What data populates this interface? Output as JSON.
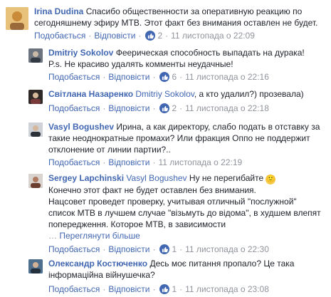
{
  "actions": {
    "like": "Подобається",
    "reply": "Відповісти",
    "dot": "·"
  },
  "comments": [
    {
      "author": "Irina Dudina",
      "text_lines": [
        "Спасибо общественности за оперативную реакцию по",
        "сегодняшнему эфиру МТВ. Этот факт без внимания оставлен не будет."
      ],
      "likes": "2",
      "time": "11 листопада о 22:09",
      "avatar_color": "#d9a13a"
    },
    {
      "author": "Dmitriy Sokolov",
      "text_lines": [
        "Феерическая способность выпадать на дурака!",
        "P.s. Не красиво удалять комменты неудачные!"
      ],
      "likes": "6",
      "time": "11 листопада о 22:16",
      "avatar_color": "#5b6470"
    },
    {
      "author": "Світлана Назаренко",
      "mention": "Dmitriy Sokolov",
      "text_after_mention": ", а кто удалил?) прозевала)",
      "likes": "2",
      "time": "11 листопада о 22:18",
      "avatar_color": "#8a5a3c"
    },
    {
      "author": "Vasyl Bogushev",
      "text_lines": [
        "Ирина, а как директору, слабо подать в отставку за",
        "такие неоднократные промахи? Или фракция Оппо не поддержит",
        "отклонение от линии партии?.."
      ],
      "time": "11 листопада о 22:19",
      "avatar_color": "#444a55"
    },
    {
      "author": "Sergey Lapchinski",
      "mention": "Vasyl Bogushev",
      "text_after_mention": " Ну не перегибайте",
      "emoji": "🙂",
      "text_lines": [
        "Конечно этот факт не будет оставлен без внимания.",
        "Нацсовет проведет проверку, учитывая отличный \"послужной\"",
        "список МТВ в лучшем случае \"візьмуть до відома\", в худшем влепят",
        "попередження. Которое МТВ, в зависимости"
      ],
      "see_more": "Переглянути більше",
      "likes": "1",
      "time": "11 листопада о 22:30",
      "avatar_color": "#7a4b3a"
    },
    {
      "author": "Олександр Костюченко",
      "text_lines_after_author": "Десь моє питання пропало? Це така",
      "text_lines": [
        "інформаційна війнушечка?"
      ],
      "likes": "1",
      "time": "11 листопада о 23:08",
      "avatar_color": "#3e5a78"
    }
  ]
}
